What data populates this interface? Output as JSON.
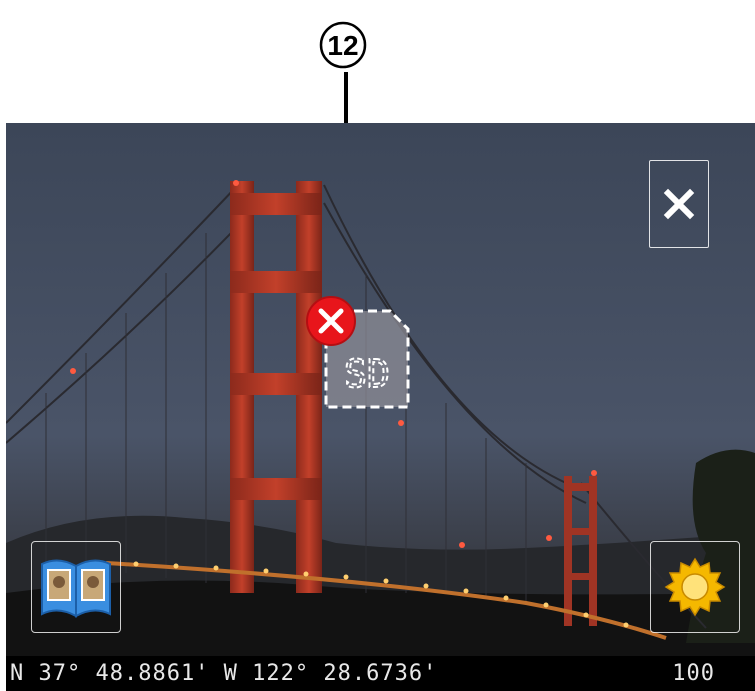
{
  "callout": {
    "label": "12"
  },
  "screen": {
    "buttons": {
      "close_icon": "close-icon",
      "gallery_icon": "photo-album-icon",
      "settings_icon": "gear-icon"
    },
    "sd_card": {
      "label": "SD",
      "status_icon": "error-x-icon",
      "status_color": "#e8151b"
    },
    "status_bar": {
      "gps_coordinates": "N 37° 48.8861' W 122° 28.6736'",
      "shots_remaining": "100"
    }
  }
}
